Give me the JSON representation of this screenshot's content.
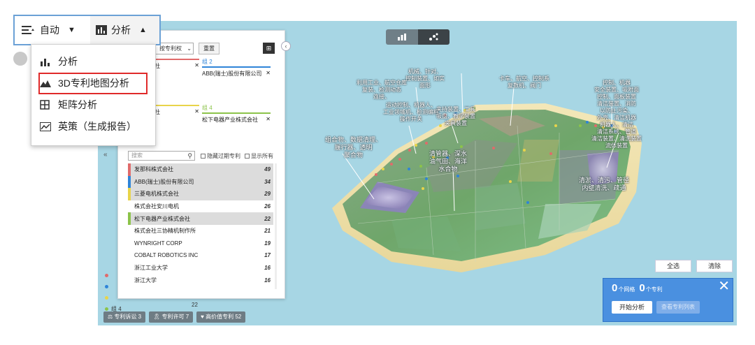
{
  "toolbar": {
    "auto_label": "自动",
    "analyze_label": "分析"
  },
  "dropdown": {
    "items": [
      {
        "label": "分析",
        "icon": "bar-chart-icon"
      },
      {
        "label": "3D专利地图分析",
        "icon": "mountain-icon",
        "highlighted": true
      },
      {
        "label": "矩阵分析",
        "icon": "grid-icon"
      },
      {
        "label": "英策（生成报告）",
        "icon": "line-chart-icon"
      }
    ]
  },
  "panel": {
    "select_value": "按专利权",
    "reset_label": "重置",
    "groups": [
      {
        "label": "",
        "value": "社",
        "color": "#e06b6b"
      },
      {
        "label": "组 2",
        "value": "ABB(瑞士)股份有限公司",
        "color": "#2f84d8"
      },
      {
        "label": "",
        "value": "社",
        "color": "#e8d44a"
      },
      {
        "label": "组 4",
        "value": "松下电器产业株式会社",
        "color": "#8cc34a"
      }
    ],
    "search_placeholder": "搜索",
    "hide_expired_label": "隐藏过期专利",
    "show_all_label": "显示所有",
    "list": [
      {
        "name": "发那科株式会社",
        "count": "49",
        "color": "#e06b6b",
        "shaded": true
      },
      {
        "name": "ABB(瑞士)股份有限公司",
        "count": "34",
        "color": "#2f84d8",
        "shaded": true
      },
      {
        "name": "三菱电机株式会社",
        "count": "29",
        "color": "#e8d44a",
        "shaded": true
      },
      {
        "name": "株式会社安川电机",
        "count": "26",
        "color": "",
        "shaded": false
      },
      {
        "name": "松下电器产业株式会社",
        "count": "22",
        "color": "#8cc34a",
        "shaded": true
      },
      {
        "name": "株式会社三协精机制作所",
        "count": "21",
        "color": "",
        "shaded": false
      },
      {
        "name": "WYNRIGHT CORP",
        "count": "19",
        "color": "",
        "shaded": false
      },
      {
        "name": "COBALT ROBOTICS INC",
        "count": "17",
        "color": "",
        "shaded": false
      },
      {
        "name": "浙江工业大学",
        "count": "16",
        "color": "",
        "shaded": false
      },
      {
        "name": "浙江大学",
        "count": "16",
        "color": "",
        "shaded": false
      }
    ]
  },
  "legend": {
    "last_group": "组 4",
    "last_count": "22"
  },
  "chips": [
    {
      "label": "专利诉讼 3",
      "icon": "gavel-icon"
    },
    {
      "label": "专利许可 7",
      "icon": "ribbon-icon"
    },
    {
      "label": "高价值专利 52",
      "icon": "heart-icon"
    }
  ],
  "map": {
    "labels": [
      {
        "text": "机械、针对、\n控制装置、如实\n面形",
        "id": "l1"
      },
      {
        "text": "利用工业、航空仓库\n复装、检测动态\n连接、",
        "id": "l2"
      },
      {
        "text": "卡车、航空、控制系\n复数机、阀门",
        "id": "l3"
      },
      {
        "text": "控制、机器\n安全装置、吸附面\n控制、面板装置\n清洁装置、消防\n以防止污染、\n外壳、清洁机器\n机器人、清洁\n清洁系统、管道\n清洁装置、清洗装置\n流体装置",
        "id": "l4"
      },
      {
        "text": "运动控制、机器人、\n工业领域机、检测编程\n操作开关",
        "id": "l5"
      },
      {
        "text": "夹持装置、工具\n吸盘、教学装置\n夹具装置",
        "id": "l6"
      },
      {
        "text": "组合物、数据清理、\n履行器、透明\n聚合物",
        "id": "l7"
      },
      {
        "text": "清管器、深水\n油气田、海洋\n水合物",
        "id": "l8"
      },
      {
        "text": "清淤、清污、管径\n内壁清洗、疏通",
        "id": "l9"
      }
    ],
    "select_all_label": "全选",
    "clear_label": "清除"
  },
  "analysis": {
    "grid_count": "0",
    "grid_unit": "个网格",
    "patent_count": "0",
    "patent_unit": "个专利",
    "start_label": "开始分析",
    "view_list_label": "查看专利列表"
  },
  "colors": {
    "accent": "#4a90e0",
    "highlight": "#e02a2a",
    "sea": "#a7d6e4"
  }
}
